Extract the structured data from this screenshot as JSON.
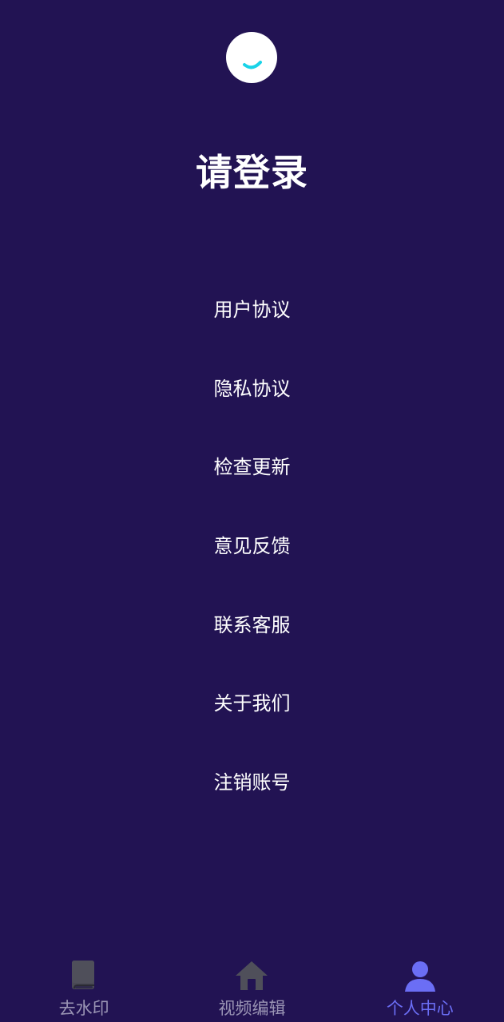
{
  "header": {
    "login_title": "请登录"
  },
  "menu": {
    "items": [
      {
        "label": "用户协议"
      },
      {
        "label": "隐私协议"
      },
      {
        "label": "检查更新"
      },
      {
        "label": "意见反馈"
      },
      {
        "label": "联系客服"
      },
      {
        "label": "关于我们"
      },
      {
        "label": "注销账号"
      }
    ]
  },
  "tabbar": {
    "items": [
      {
        "label": "去水印",
        "icon": "book-icon",
        "active": false
      },
      {
        "label": "视频编辑",
        "icon": "home-icon",
        "active": false
      },
      {
        "label": "个人中心",
        "icon": "user-icon",
        "active": true
      }
    ]
  },
  "colors": {
    "background": "#221353",
    "accent": "#6b6ef5",
    "avatar_smile": "#19d3e8",
    "inactive_tab": "#9a94b4"
  }
}
